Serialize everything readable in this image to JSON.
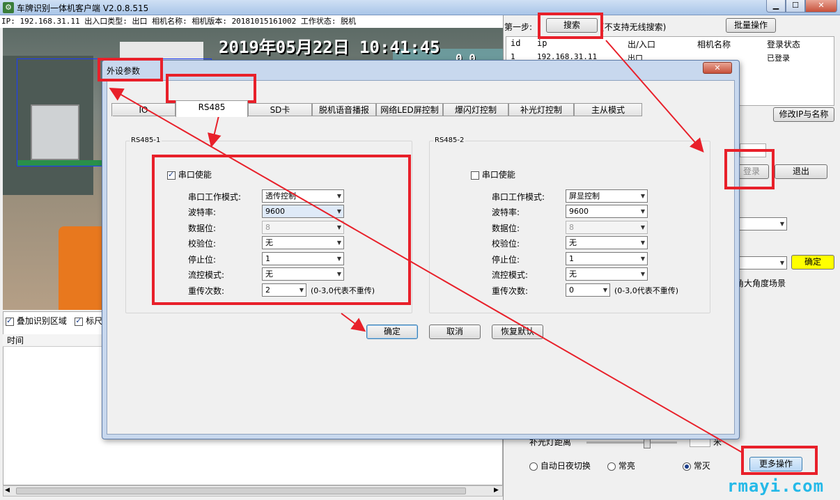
{
  "window": {
    "title": "车牌识别一体机客户端 V2.0.8.515",
    "icon_text": "⚙",
    "min": "▁",
    "max": "☐",
    "close": "✕"
  },
  "infobar": "IP: 192.168.31.11  出入口类型: 出口  相机名称:  相机版本: 20181015161002  工作状态: 脱机",
  "video": {
    "osd": "2019年05月22日   10:41:45",
    "osd2": "0.0"
  },
  "overlay": {
    "opt1": "叠加识别区域",
    "opt2": "标尺"
  },
  "log": {
    "col_time": "时间"
  },
  "right": {
    "step1": "第一步:",
    "search_button": "搜索",
    "search_note": "(不支持无线搜索)",
    "batch_button": "批量操作",
    "table": {
      "headers": [
        "id",
        "ip",
        "出/入口",
        "相机名称",
        "登录状态"
      ],
      "rows": [
        [
          "1",
          "192.168.31.11",
          "出口",
          "",
          "已登录"
        ]
      ]
    },
    "modify_ip_button": "修改IP与名称",
    "login_button": "登录",
    "logout_button": "退出",
    "confirm_button": "确定",
    "wide_angle": "角大角度场景",
    "fill_light": "补光灯距离",
    "fill_unit": "米",
    "radio_auto": "自动日夜切换",
    "radio_on": "常亮",
    "radio_off": "常灭",
    "more_button": "更多操作",
    "colors": {
      "confirm_bg": "#ffff00"
    }
  },
  "dialog": {
    "title": "外设参数",
    "close": "✕",
    "tabs": [
      "IO",
      "RS485",
      "SD卡",
      "脱机语音播报",
      "网络LED屏控制",
      "爆闪灯控制",
      "补光灯控制",
      "主从模式"
    ],
    "active_tab": "RS485",
    "rs1": {
      "group": "RS485-1",
      "enable": "串口使能",
      "labels": [
        "串口工作模式:",
        "波特率:",
        "数据位:",
        "校验位:",
        "停止位:",
        "流控模式:",
        "重传次数:"
      ],
      "values": [
        "透传控制",
        "9600",
        "8",
        "无",
        "1",
        "无",
        "2"
      ],
      "retry_note": "(0-3,0代表不重传)"
    },
    "rs2": {
      "group": "RS485-2",
      "enable": "串口使能",
      "labels": [
        "串口工作模式:",
        "波特率:",
        "数据位:",
        "校验位:",
        "停止位:",
        "流控模式:",
        "重传次数:"
      ],
      "values": [
        "屏显控制",
        "9600",
        "8",
        "无",
        "1",
        "无",
        "0"
      ],
      "retry_note": "(0-3,0代表不重传)"
    },
    "ok": "确定",
    "cancel": "取消",
    "restore": "恢复默认"
  },
  "watermark": "rmayi.com",
  "annotation_color": "#e8202a"
}
